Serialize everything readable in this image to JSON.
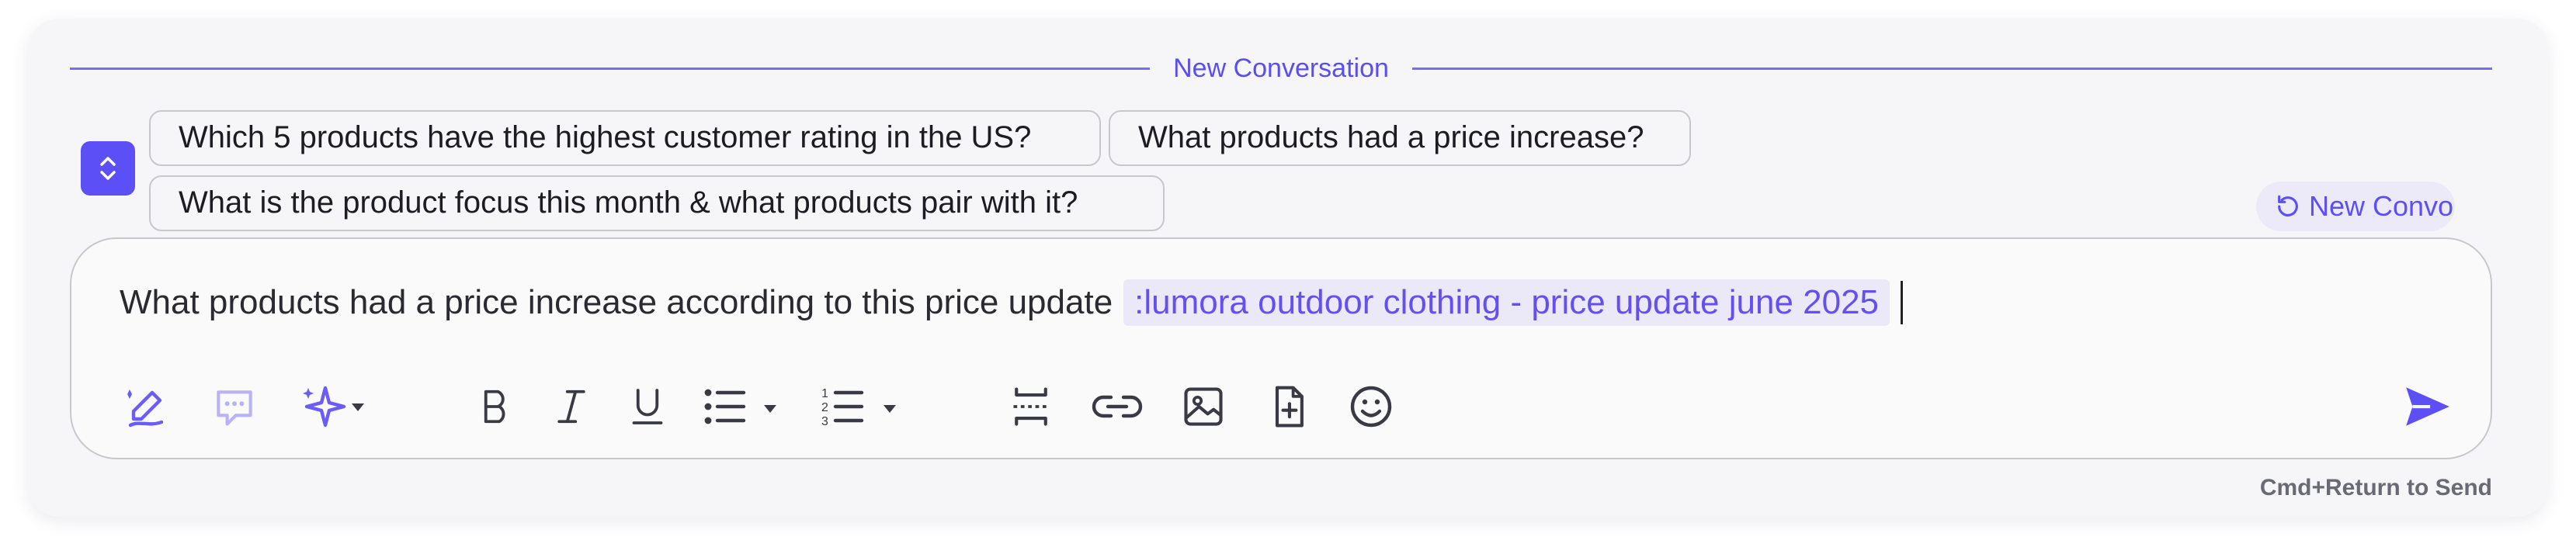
{
  "header": {
    "title": "New Conversation"
  },
  "suggestions": [
    "Which 5 products have the highest customer rating in the US?",
    "What products had a price increase?",
    "What is the product focus this month & what products pair with it?"
  ],
  "new_convo_label": "New Convo",
  "composer": {
    "text": "What products had a price increase according to this price update",
    "mention": ":lumora outdoor clothing - price update june 2025"
  },
  "toolbar": {
    "icons": [
      "pen-sparkle-icon",
      "comment-icon",
      "ai-sparkle-icon",
      "bold-icon",
      "italic-icon",
      "underline-icon",
      "bullet-list-icon",
      "numbered-list-icon",
      "page-break-icon",
      "link-icon",
      "image-icon",
      "file-add-icon",
      "emoji-icon",
      "send-icon"
    ]
  },
  "footer": {
    "hint": "Cmd+Return to Send"
  },
  "colors": {
    "accent": "#5b4ff5",
    "mention_bg": "#ebe8f7",
    "panel_bg": "#f6f6f8"
  }
}
